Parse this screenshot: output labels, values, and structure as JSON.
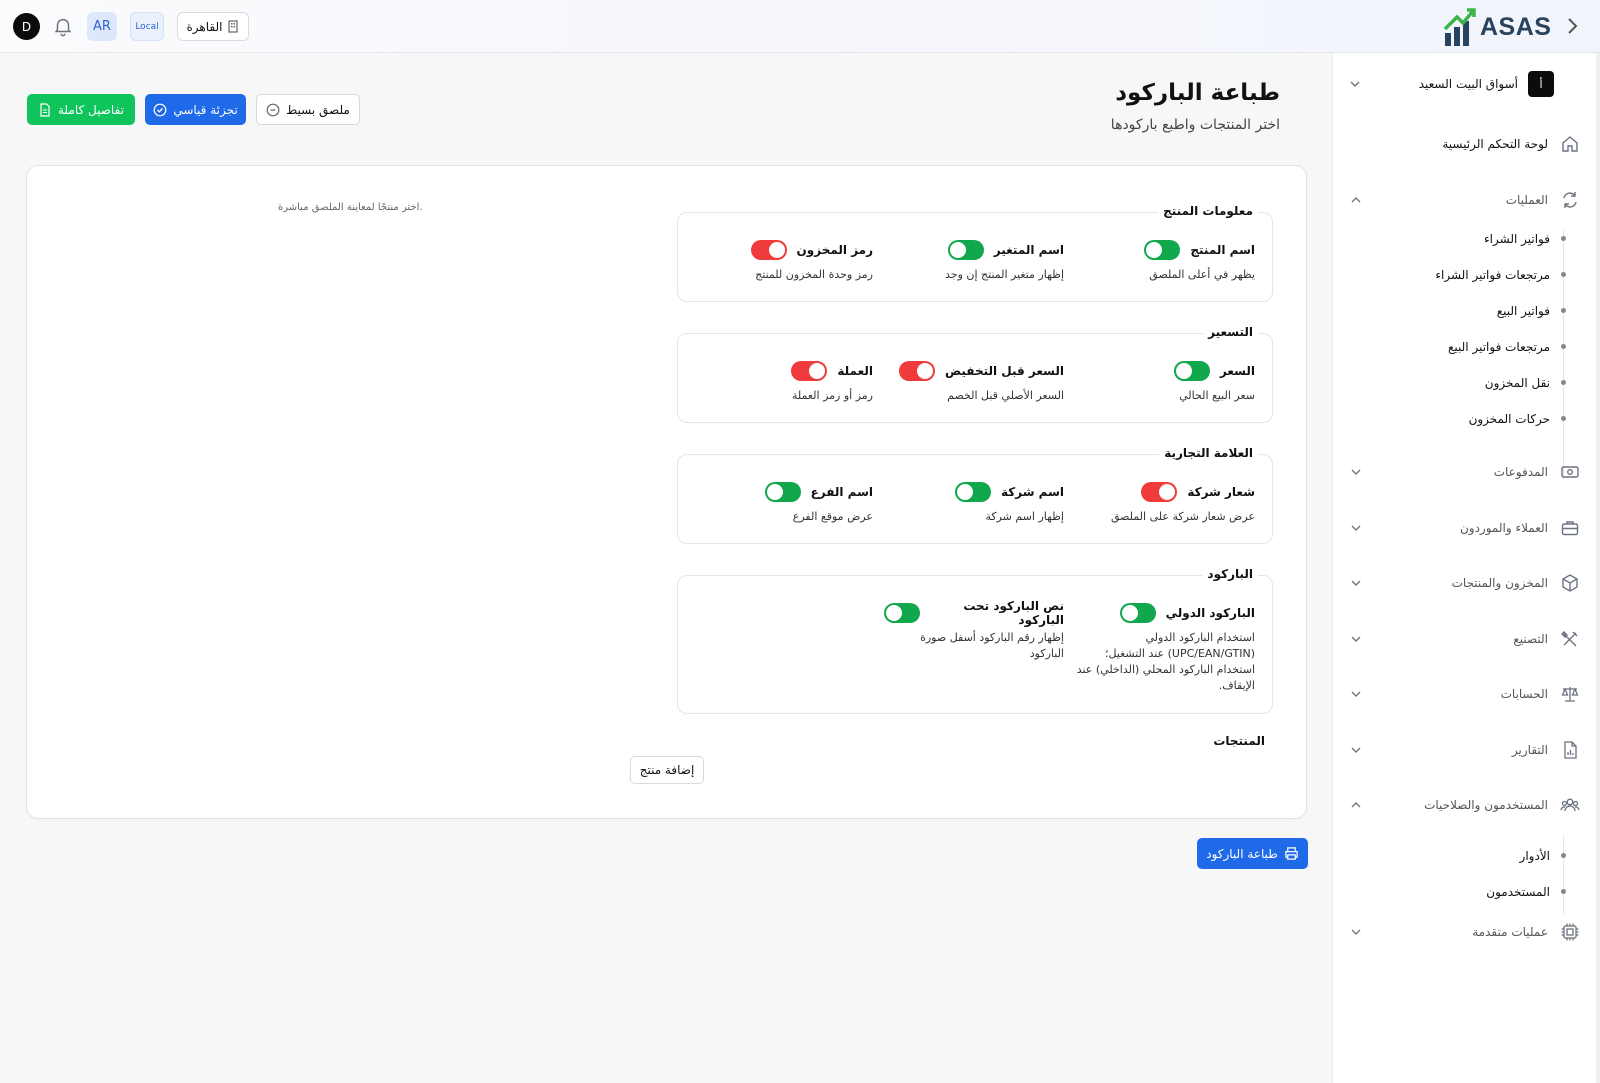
{
  "header": {
    "logo_text": "ASAS",
    "avatar_initial": "D",
    "language": "AR",
    "environment": "Local",
    "branch": "القاهرة"
  },
  "sidebar": {
    "company": "أسواق البيت السعيد",
    "company_logo": "أ",
    "items": [
      {
        "label": "لوحة التحكم الرئيسية",
        "icon": "home-icon"
      },
      {
        "label": "العمليات",
        "icon": "refresh-icon",
        "expanded": true,
        "children": [
          "فواتير الشراء",
          "مرتجعات فواتير الشراء",
          "فواتير البيع",
          "مرتجعات فواتير البيع",
          "نقل المخزون",
          "حركات المخزون"
        ]
      },
      {
        "label": "المدفوعات",
        "icon": "payment-icon"
      },
      {
        "label": "العملاء والموردون",
        "icon": "briefcase-icon"
      },
      {
        "label": "المخزون والمنتجات",
        "icon": "box-icon"
      },
      {
        "label": "التصنيع",
        "icon": "tools-icon"
      },
      {
        "label": "الحسابات",
        "icon": "scale-icon"
      },
      {
        "label": "التقارير",
        "icon": "report-icon"
      },
      {
        "label": "المستخدمون والصلاحيات",
        "icon": "users-icon",
        "expanded": true,
        "children": [
          "الأدوار",
          "المستخدمون"
        ]
      },
      {
        "label": "عمليات متقدمة",
        "icon": "chip-icon"
      }
    ]
  },
  "page": {
    "title": "طباعة الباركود",
    "subtitle": "اختر المنتجات واطبع باركودها",
    "modes": {
      "full": "تفاصيل كاملة",
      "standard": "تجزئة قياسي",
      "simple": "ملصق بسيط"
    },
    "preview_hint": "اختر منتجًا لمعاينة الملصق مباشرة.",
    "products_label": "المنتجات",
    "add_product": "إضافة منتج",
    "print_button": "طباعة الباركود"
  },
  "groups": {
    "product_info": {
      "title": "معلومات المنتج",
      "options": [
        {
          "label": "اسم المنتج",
          "desc": "يظهر في أعلى الملصق",
          "on": true
        },
        {
          "label": "اسم المتغير",
          "desc": "إظهار متغير المنتج إن وجد",
          "on": true
        },
        {
          "label": "رمز المخزون",
          "desc": "رمز وحدة المخزون للمنتج",
          "on": false
        }
      ]
    },
    "pricing": {
      "title": "التسعير",
      "options": [
        {
          "label": "السعر",
          "desc": "سعر البيع الحالي",
          "on": true
        },
        {
          "label": "السعر قبل التخفيض",
          "desc": "السعر الأصلي قبل الخصم",
          "on": false
        },
        {
          "label": "العملة",
          "desc": "رمز أو رمز العملة",
          "on": false
        }
      ]
    },
    "branding": {
      "title": "العلامة التجارية",
      "options": [
        {
          "label": "شعار شركة",
          "desc": "عرض شعار شركة على الملصق",
          "on": false
        },
        {
          "label": "اسم شركة",
          "desc": "إظهار اسم شركة",
          "on": true
        },
        {
          "label": "اسم الفرع",
          "desc": "عرض موقع الفرع",
          "on": true
        }
      ]
    },
    "barcode": {
      "title": "الباركود",
      "options": [
        {
          "label": "الباركود الدولي",
          "desc": "استخدام الباركود الدولي (UPC/EAN/GTIN) عند التشغيل؛ استخدام الباركود المحلي (الداخلي) عند الإيقاف.",
          "on": true
        },
        {
          "label": "نص الباركود تحت الباركود",
          "desc": "إظهار رقم الباركود أسفل صورة الباركود",
          "on": true
        }
      ]
    }
  }
}
